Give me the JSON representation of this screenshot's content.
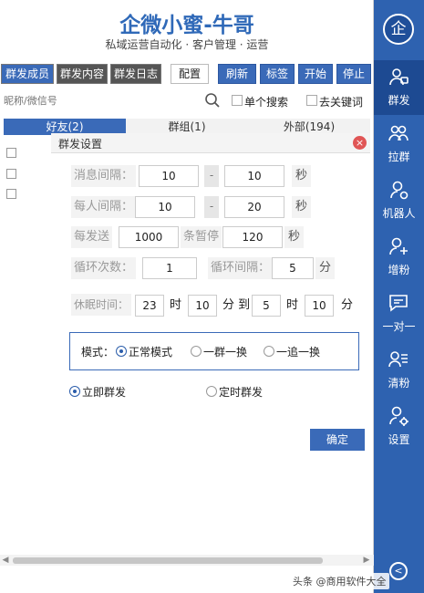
{
  "header": {
    "title": "企微小蜜-牛哥",
    "subtitle": "私域运营自动化 · 客户管理 · 运营"
  },
  "toolbar": {
    "buttons": [
      "群发成员",
      "群发内容",
      "群发日志",
      "配置",
      "刷新",
      "标签",
      "开始",
      "停止"
    ]
  },
  "search": {
    "placeholder": "昵称/微信号",
    "single_search_label": "单个搜索",
    "exclude_keyword_label": "去关键词"
  },
  "tabs": [
    "好友(2)",
    "群组(1)",
    "外部(194)"
  ],
  "dialog": {
    "title": "群发设置",
    "close_glyph": "×",
    "msg_interval": {
      "label": "消息间隔：",
      "min": "10",
      "sep": "-",
      "max": "10",
      "unit": "秒"
    },
    "person_interval": {
      "label": "每人间隔：",
      "min": "10",
      "sep": "-",
      "max": "20",
      "unit": "秒"
    },
    "batch": {
      "label": "每发送",
      "count": "1000",
      "mid": "条暂停",
      "pause": "120",
      "unit": "秒"
    },
    "loop": {
      "count_label": "循环次数：",
      "count": "1",
      "interval_label": "循环间隔：",
      "interval": "5",
      "unit": "分"
    },
    "sleep": {
      "label": "休眠时间：",
      "start_hour": "23",
      "hour_unit": "时",
      "start_min": "10",
      "to_label": "分 到",
      "end_hour": "5",
      "end_hour_unit": "时",
      "end_min": "10",
      "min_unit": "分"
    },
    "mode": {
      "label": "模式：",
      "options": [
        "正常模式",
        "一群一换",
        "一追一换"
      ],
      "selected": 0
    },
    "send_type": {
      "options": [
        "立即群发",
        "定时群发"
      ],
      "selected": 0
    },
    "confirm_label": "确定"
  },
  "sidebar": {
    "logo_text": "企",
    "items": [
      "群发",
      "拉群",
      "机器人",
      "增粉",
      "一对一",
      "清粉",
      "设置"
    ],
    "active_index": 0,
    "bottom_glyph": "<"
  },
  "watermark": "头条 @商用软件大全",
  "colors": {
    "accent": "#2e62b0",
    "title": "#2f69b8",
    "close": "#e05555"
  }
}
